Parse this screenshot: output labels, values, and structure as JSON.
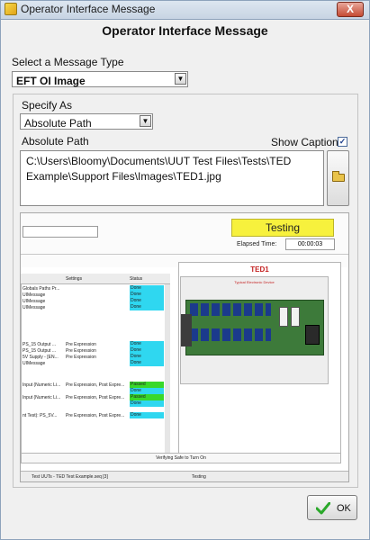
{
  "window": {
    "title": "Operator Interface Message",
    "close_glyph": "X"
  },
  "heading": "Operator Interface Message",
  "message_type": {
    "label": "Select a Message Type",
    "value": "EFT OI Image"
  },
  "specify_as": {
    "label": "Specify As",
    "value": "Absolute Path"
  },
  "path": {
    "label": "Absolute Path",
    "value": "C:\\Users\\Bloomy\\Documents\\UUT Test Files\\Tests\\TED\nExample\\Support Files\\Images\\TED1.jpg"
  },
  "show_caption": {
    "label": "Show Caption",
    "checked": "✓"
  },
  "preview": {
    "status_badge": "Testing",
    "elapsed_label": "Elapsed Time:",
    "elapsed_value": "00:00:03",
    "image_caption": "TED1",
    "board_subtitle": "Typical Electronic Device",
    "columns": [
      "Settings",
      "Status"
    ],
    "rows": [
      {
        "step": "Globals Paths Pr...",
        "settings": "",
        "status": "Done"
      },
      {
        "step": "UIMessage",
        "settings": "",
        "status": "Done"
      },
      {
        "step": "UIMessage",
        "settings": "",
        "status": "Done"
      },
      {
        "step": "UIMessage",
        "settings": "",
        "status": "Done"
      },
      {
        "step": "PS_15 Output ...",
        "settings": "Pre Expression",
        "status": "Done"
      },
      {
        "step": "PS_15 Output ...",
        "settings": "Pre Expression",
        "status": "Done"
      },
      {
        "step": "5V Supply - [EN...",
        "settings": "Pre Expression",
        "status": "Done"
      },
      {
        "step": "UIMessage",
        "settings": "",
        "status": "Done"
      },
      {
        "step": "Input (Numeric Li...",
        "settings": "Pre Expression, Post Expre...",
        "status": "Passed"
      },
      {
        "step": "",
        "settings": "",
        "status": "Done"
      },
      {
        "step": "Input (Numeric Li...",
        "settings": "Pre Expression, Post Expre...",
        "status": "Passed"
      },
      {
        "step": "",
        "settings": "",
        "status": "Done"
      },
      {
        "step": "nt Test): PS_5V...",
        "settings": "Pre Expression, Post Expre...",
        "status": "Done"
      }
    ],
    "footer_status": "Verifying Safe to Turn On",
    "statusbar_left": "Test UUTs - TED Test Example.seq [3]",
    "statusbar_right": "Testing"
  },
  "ok_button": {
    "label": "OK"
  },
  "colors": {
    "done": "#2fd7f0",
    "passed": "#39d82a",
    "testing_badge": "#f7f13d"
  }
}
